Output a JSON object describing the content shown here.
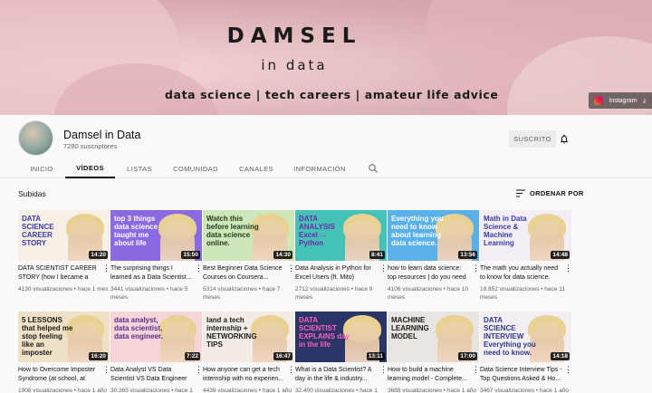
{
  "banner": {
    "title": "DAMSEL",
    "subtitle": "in data",
    "tagline": "data science | tech careers | amateur life advice",
    "social": {
      "instagram_label": "Instagram",
      "tiktok_glyph": "♪"
    }
  },
  "channel": {
    "name": "Damsel in Data",
    "subscribers": "7280 suscriptores",
    "subscribe_label": "SUSCRITO"
  },
  "tabs": [
    "INICIO",
    "VÍDEOS",
    "LISTAS",
    "COMUNIDAD",
    "CANALES",
    "INFORMACIÓN"
  ],
  "active_tab": "VÍDEOS",
  "section": {
    "title": "Subidas",
    "sort_label": "ORDENAR POR"
  },
  "videos": [
    {
      "title": "DATA SCIENTIST CAREER STORY (how I became a dat...",
      "views": "4130 visualizaciones",
      "age": "hace 1 mes",
      "duration": "14:20",
      "thumb_text": "DATA SCIENCE CAREER STORY",
      "bg": "#f6f0e6",
      "fg": "#3a3aa8"
    },
    {
      "title": "The surprising things I learned as a Data Scientist...",
      "views": "3441 visualizaciones",
      "age": "hace 5 meses",
      "duration": "15:50",
      "thumb_text": "top 3 things data science taught me about life",
      "bg": "#8a6ae0",
      "fg": "#ffffff"
    },
    {
      "title": "Best Beginner Data Science Courses on Coursera...",
      "views": "5314 visualizaciones",
      "age": "hace 7 meses",
      "duration": "14:30",
      "thumb_text": "Watch this before learning data science online.",
      "bg": "#cfe6b8",
      "fg": "#1b3a1b"
    },
    {
      "title": "Data Analysis in Python for Excel Users (ft. Mito)",
      "views": "2712 visualizaciones",
      "age": "hace 9 meses",
      "duration": "8:41",
      "thumb_text": "DATA ANALYSIS Excel → Python",
      "bg": "#45c2b8",
      "fg": "#6b2aa8"
    },
    {
      "title": "how to learn data science: top resources | do you need ...",
      "views": "4106 visualizaciones",
      "age": "hace 10 meses",
      "duration": "13:56",
      "thumb_text": "Everything you need to know about learning data science.",
      "bg": "#5ab0e8",
      "fg": "#ffffff"
    },
    {
      "title": "The math you actually need to know for data science.",
      "views": "18.852 visualizaciones",
      "age": "hace 11 meses",
      "duration": "14:48",
      "thumb_text": "Math in Data Science & Machine Learning",
      "bg": "#f3eef3",
      "fg": "#3a3aa8"
    },
    {
      "title": "How to Overcome Imposter Syndrome (at school, at wor...",
      "views": "1908 visualizaciones",
      "age": "hace 1 año",
      "duration": "16:20",
      "thumb_text": "5 LESSONS that helped me stop feeling like an imposter",
      "bg": "#efe0c6",
      "fg": "#1b1b1b"
    },
    {
      "title": "Data Analyst VS Data Scientist VS Data Engineer",
      "views": "30.365 visualizaciones",
      "age": "hace 1 año",
      "duration": "7:22",
      "thumb_text": "data analyst, data scientist, data engineer.",
      "bg": "#f4d6d9",
      "fg": "#5b2a8a"
    },
    {
      "title": "How anyone can get a tech internship with no experien...",
      "views": "4439 visualizaciones",
      "age": "hace 1 año",
      "duration": "16:47",
      "thumb_text": "land a tech internship + NETWORKING TIPS",
      "bg": "#f2ece4",
      "fg": "#1b1b1b"
    },
    {
      "title": "What is a Data Scientist? A day in the life & industry...",
      "views": "32.400 visualizaciones",
      "age": "hace 1 año",
      "duration": "13:11",
      "thumb_text": "DATA SCIENTIST EXPLAINS day in the life",
      "bg": "#2a3566",
      "fg": "#ff5ec4"
    },
    {
      "title": "How to build a machine learning model - Complete...",
      "views": "3688 visualizaciones",
      "age": "hace 1 año",
      "duration": "17:00",
      "thumb_text": "MACHINE LEARNING MODEL",
      "bg": "#e8e4df",
      "fg": "#1b1b1b"
    },
    {
      "title": "Data Science Interview Tips - Top Questions Asked & Ho...",
      "views": "3467 visualizaciones",
      "age": "hace 1 año",
      "duration": "14:18",
      "thumb_text": "DATA SCIENCE INTERVIEW Everything you need to know.",
      "bg": "#f4eef2",
      "fg": "#2a3a8a"
    }
  ]
}
